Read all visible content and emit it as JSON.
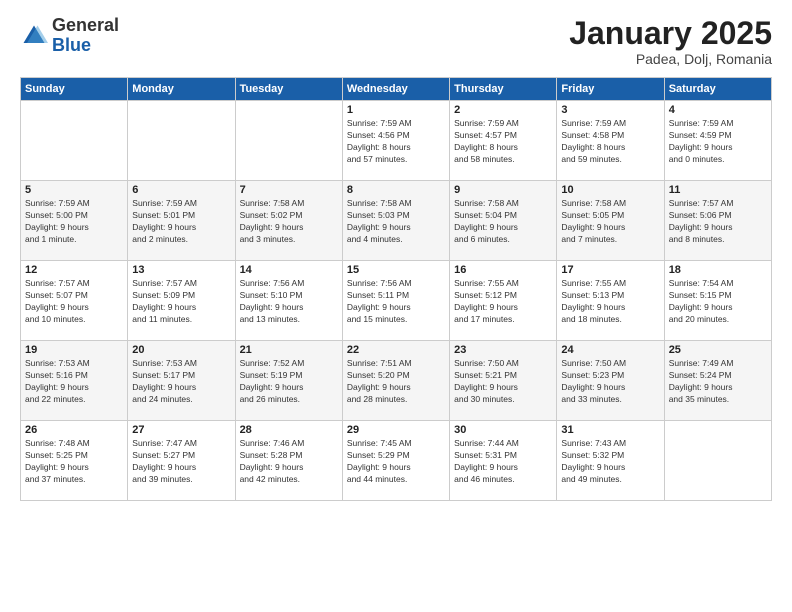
{
  "header": {
    "logo_general": "General",
    "logo_blue": "Blue",
    "month": "January 2025",
    "location": "Padea, Dolj, Romania"
  },
  "weekdays": [
    "Sunday",
    "Monday",
    "Tuesday",
    "Wednesday",
    "Thursday",
    "Friday",
    "Saturday"
  ],
  "weeks": [
    [
      {
        "day": "",
        "info": ""
      },
      {
        "day": "",
        "info": ""
      },
      {
        "day": "",
        "info": ""
      },
      {
        "day": "1",
        "info": "Sunrise: 7:59 AM\nSunset: 4:56 PM\nDaylight: 8 hours\nand 57 minutes."
      },
      {
        "day": "2",
        "info": "Sunrise: 7:59 AM\nSunset: 4:57 PM\nDaylight: 8 hours\nand 58 minutes."
      },
      {
        "day": "3",
        "info": "Sunrise: 7:59 AM\nSunset: 4:58 PM\nDaylight: 8 hours\nand 59 minutes."
      },
      {
        "day": "4",
        "info": "Sunrise: 7:59 AM\nSunset: 4:59 PM\nDaylight: 9 hours\nand 0 minutes."
      }
    ],
    [
      {
        "day": "5",
        "info": "Sunrise: 7:59 AM\nSunset: 5:00 PM\nDaylight: 9 hours\nand 1 minute."
      },
      {
        "day": "6",
        "info": "Sunrise: 7:59 AM\nSunset: 5:01 PM\nDaylight: 9 hours\nand 2 minutes."
      },
      {
        "day": "7",
        "info": "Sunrise: 7:58 AM\nSunset: 5:02 PM\nDaylight: 9 hours\nand 3 minutes."
      },
      {
        "day": "8",
        "info": "Sunrise: 7:58 AM\nSunset: 5:03 PM\nDaylight: 9 hours\nand 4 minutes."
      },
      {
        "day": "9",
        "info": "Sunrise: 7:58 AM\nSunset: 5:04 PM\nDaylight: 9 hours\nand 6 minutes."
      },
      {
        "day": "10",
        "info": "Sunrise: 7:58 AM\nSunset: 5:05 PM\nDaylight: 9 hours\nand 7 minutes."
      },
      {
        "day": "11",
        "info": "Sunrise: 7:57 AM\nSunset: 5:06 PM\nDaylight: 9 hours\nand 8 minutes."
      }
    ],
    [
      {
        "day": "12",
        "info": "Sunrise: 7:57 AM\nSunset: 5:07 PM\nDaylight: 9 hours\nand 10 minutes."
      },
      {
        "day": "13",
        "info": "Sunrise: 7:57 AM\nSunset: 5:09 PM\nDaylight: 9 hours\nand 11 minutes."
      },
      {
        "day": "14",
        "info": "Sunrise: 7:56 AM\nSunset: 5:10 PM\nDaylight: 9 hours\nand 13 minutes."
      },
      {
        "day": "15",
        "info": "Sunrise: 7:56 AM\nSunset: 5:11 PM\nDaylight: 9 hours\nand 15 minutes."
      },
      {
        "day": "16",
        "info": "Sunrise: 7:55 AM\nSunset: 5:12 PM\nDaylight: 9 hours\nand 17 minutes."
      },
      {
        "day": "17",
        "info": "Sunrise: 7:55 AM\nSunset: 5:13 PM\nDaylight: 9 hours\nand 18 minutes."
      },
      {
        "day": "18",
        "info": "Sunrise: 7:54 AM\nSunset: 5:15 PM\nDaylight: 9 hours\nand 20 minutes."
      }
    ],
    [
      {
        "day": "19",
        "info": "Sunrise: 7:53 AM\nSunset: 5:16 PM\nDaylight: 9 hours\nand 22 minutes."
      },
      {
        "day": "20",
        "info": "Sunrise: 7:53 AM\nSunset: 5:17 PM\nDaylight: 9 hours\nand 24 minutes."
      },
      {
        "day": "21",
        "info": "Sunrise: 7:52 AM\nSunset: 5:19 PM\nDaylight: 9 hours\nand 26 minutes."
      },
      {
        "day": "22",
        "info": "Sunrise: 7:51 AM\nSunset: 5:20 PM\nDaylight: 9 hours\nand 28 minutes."
      },
      {
        "day": "23",
        "info": "Sunrise: 7:50 AM\nSunset: 5:21 PM\nDaylight: 9 hours\nand 30 minutes."
      },
      {
        "day": "24",
        "info": "Sunrise: 7:50 AM\nSunset: 5:23 PM\nDaylight: 9 hours\nand 33 minutes."
      },
      {
        "day": "25",
        "info": "Sunrise: 7:49 AM\nSunset: 5:24 PM\nDaylight: 9 hours\nand 35 minutes."
      }
    ],
    [
      {
        "day": "26",
        "info": "Sunrise: 7:48 AM\nSunset: 5:25 PM\nDaylight: 9 hours\nand 37 minutes."
      },
      {
        "day": "27",
        "info": "Sunrise: 7:47 AM\nSunset: 5:27 PM\nDaylight: 9 hours\nand 39 minutes."
      },
      {
        "day": "28",
        "info": "Sunrise: 7:46 AM\nSunset: 5:28 PM\nDaylight: 9 hours\nand 42 minutes."
      },
      {
        "day": "29",
        "info": "Sunrise: 7:45 AM\nSunset: 5:29 PM\nDaylight: 9 hours\nand 44 minutes."
      },
      {
        "day": "30",
        "info": "Sunrise: 7:44 AM\nSunset: 5:31 PM\nDaylight: 9 hours\nand 46 minutes."
      },
      {
        "day": "31",
        "info": "Sunrise: 7:43 AM\nSunset: 5:32 PM\nDaylight: 9 hours\nand 49 minutes."
      },
      {
        "day": "",
        "info": ""
      }
    ]
  ]
}
